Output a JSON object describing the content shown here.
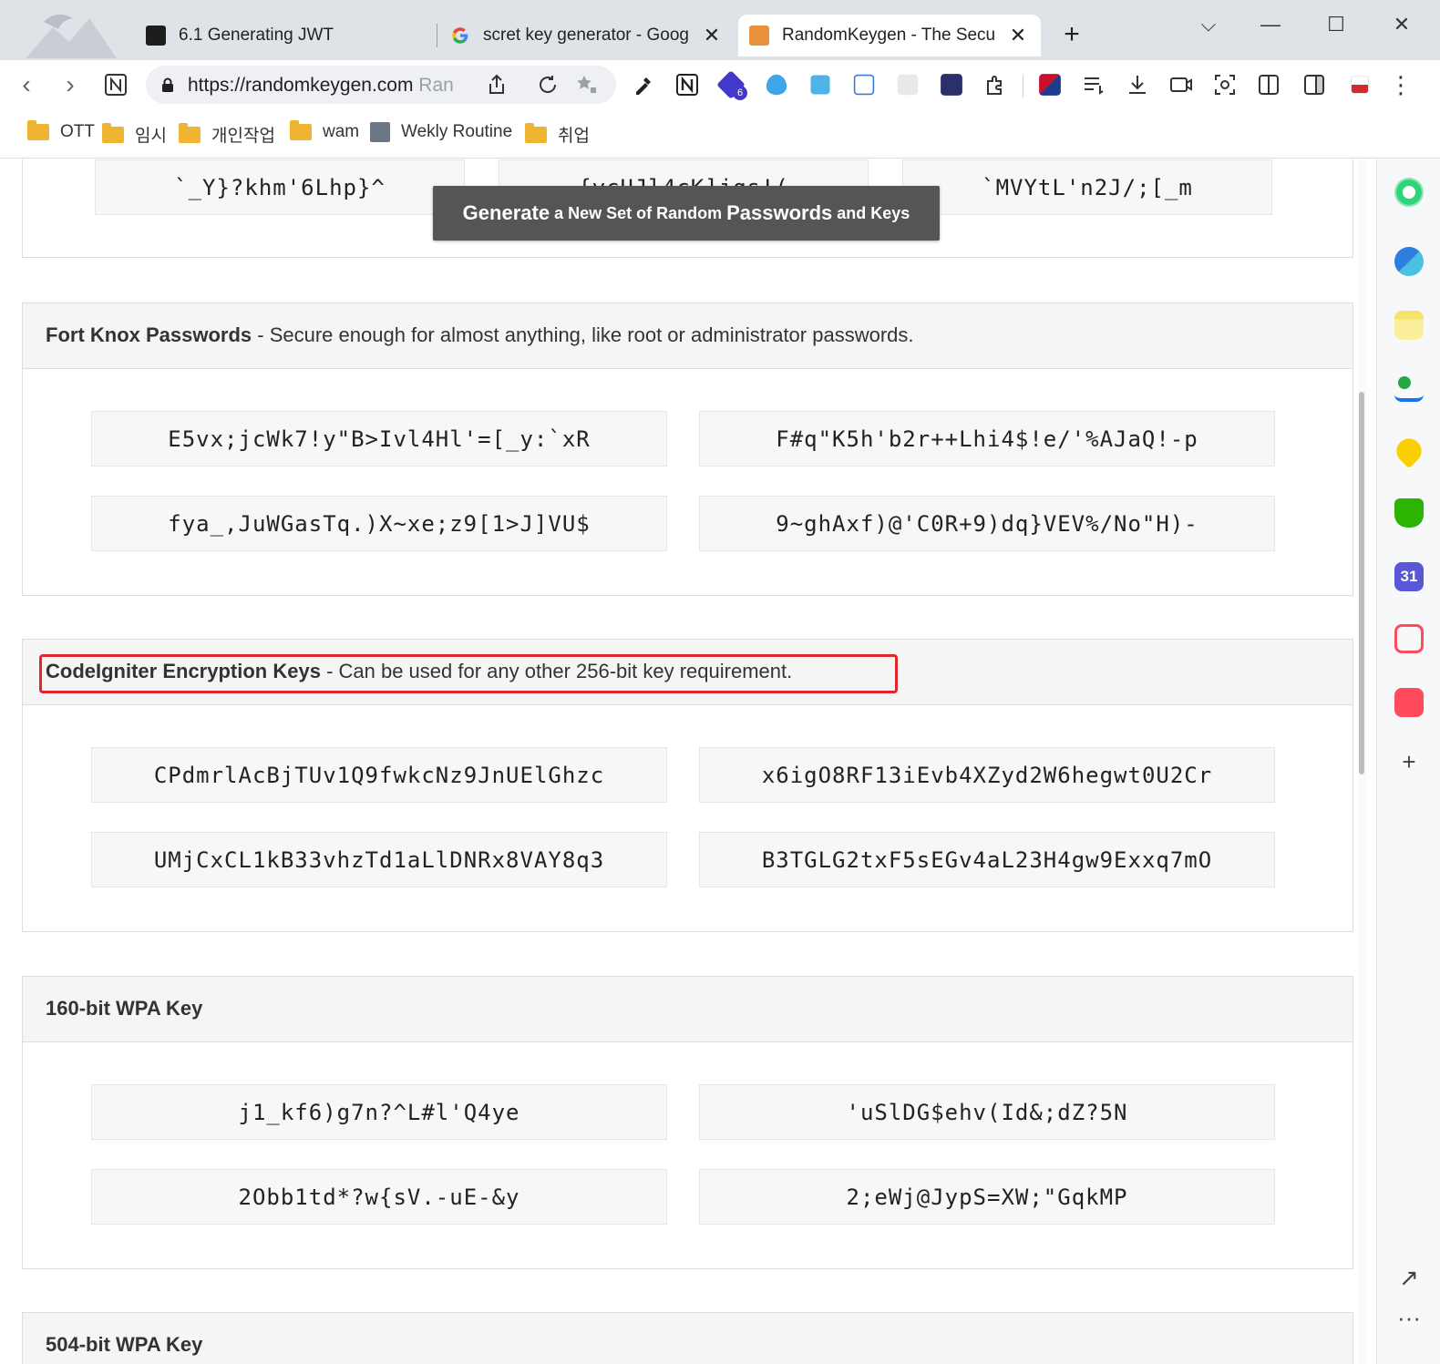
{
  "browser": {
    "tabs": [
      {
        "title": "6.1 Generating JWT"
      },
      {
        "title": "scret key generator - Goog"
      },
      {
        "title": "RandomKeygen - The Secu"
      }
    ],
    "close_glyph": "✕",
    "new_tab_glyph": "+",
    "window": {
      "dropdown": "⌵",
      "minimize": "—",
      "maximize": "☐",
      "close": "✕"
    },
    "address": {
      "url": "https://randomkeygen.com",
      "url_suffix": " Ran"
    },
    "bookmarks": [
      {
        "label": "OTT",
        "icon": "folder-icon"
      },
      {
        "label": "임시",
        "icon": "folder-icon"
      },
      {
        "label": "개인작업",
        "icon": "folder-icon"
      },
      {
        "label": "wam",
        "icon": "folder-icon"
      },
      {
        "label": "Wekly Routine",
        "icon": "page-icon"
      },
      {
        "label": "취업",
        "icon": "folder-icon"
      }
    ],
    "extension_badge": "6"
  },
  "page": {
    "generate_button": {
      "w1": "Generate",
      "w2": " a New Set of Random ",
      "w3": "Passwords",
      "w4": " and Keys"
    },
    "top_panel": {
      "keys": [
        "`_Y}?khm'6Lhp}^",
        "{ycUJl4cK]jqs!(",
        "`MVYtL'n2J/;[_m"
      ]
    },
    "fort_knox": {
      "title": "Fort Knox Passwords",
      "desc": " - Secure enough for almost anything, like root or administrator passwords.",
      "keys": [
        "E5vx;jcWk7!y\"B>Ivl4Hl'=[_y:`xR",
        "F#q\"K5h'b2r++Lhi4$!e/'%AJaQ!-p",
        "fya_,JuWGasTq.)X~xe;z9[1>J]VU$",
        "9~ghAxf)@'C0R+9)dq}VEV%/No\"H)-"
      ]
    },
    "codeigniter": {
      "title": "CodeIgniter Encryption Keys",
      "desc": " - Can be used for any other 256-bit key requirement.",
      "keys": [
        "CPdmrlAcBjTUv1Q9fwkcNz9JnUElGhzc",
        "x6igO8RF13iEvb4XZyd2W6hegwt0U2Cr",
        "UMjCxCL1kB33vhzTd1aLlDNRx8VAY8q3",
        "B3TGLG2txF5sEGv4aL23H4gw9Exxq7mO"
      ]
    },
    "wpa160": {
      "title": "160-bit WPA Key",
      "keys": [
        "j1_kf6)g7n?^L#l'Q4ye",
        "'uSlDG$ehv(Id&;dZ?5N",
        "2Obb1td*?w{sV.-uE-&y",
        "2;eWj@JypS=XW;\"GqkMP"
      ]
    },
    "wpa504": {
      "title": "504-bit WPA Key"
    }
  },
  "sidebar": {
    "calendar_day": "31",
    "add_glyph": "+",
    "external_glyph": "↗",
    "more_glyph": "···"
  },
  "colors": {
    "highlight": "#e0262f",
    "button_bg": "#555555",
    "panel_head_bg": "#f5f5f5"
  }
}
